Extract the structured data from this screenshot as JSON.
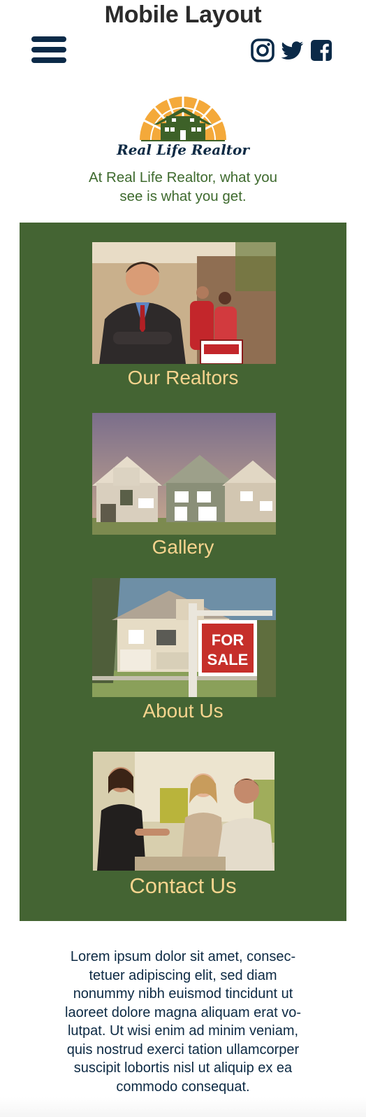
{
  "page": {
    "title": "Mobile Layout"
  },
  "header": {
    "menu_icon": "hamburger-menu-icon",
    "social": [
      {
        "name": "instagram-icon"
      },
      {
        "name": "twitter-icon"
      },
      {
        "name": "facebook-icon"
      }
    ]
  },
  "brand": {
    "name": "Real Life Realtor",
    "tagline_line1": "At Real Life Realtor, what you",
    "tagline_line2": "see is what you get."
  },
  "nav": {
    "items": [
      {
        "label": "Our Realtors",
        "image": "realtor-with-couple-photo"
      },
      {
        "label": "Gallery",
        "image": "row-of-houses-photo"
      },
      {
        "label": "About Us",
        "image": "for-sale-sign-house-photo"
      },
      {
        "label": "Contact Us",
        "image": "meeting-clients-photo"
      }
    ]
  },
  "body_text": {
    "lines": [
      "Lorem ipsum dolor sit amet, consec-",
      "tetuer adipiscing elit, sed diam",
      "nonummy nibh euismod tincidunt ut",
      "laoreet dolore magna aliquam erat vo-",
      "lutpat. Ut wisi enim ad minim veniam,",
      "quis nostrud exerci tation ullamcorper",
      "suscipit lobortis nisl ut aliquip ex ea",
      "commodo consequat."
    ]
  },
  "colors": {
    "panel_green": "#446433",
    "nav_label_gold": "#f6d48e",
    "navy": "#0b2a48",
    "tagline_green": "#3e6a2e",
    "sun_orange": "#f4a93a"
  }
}
